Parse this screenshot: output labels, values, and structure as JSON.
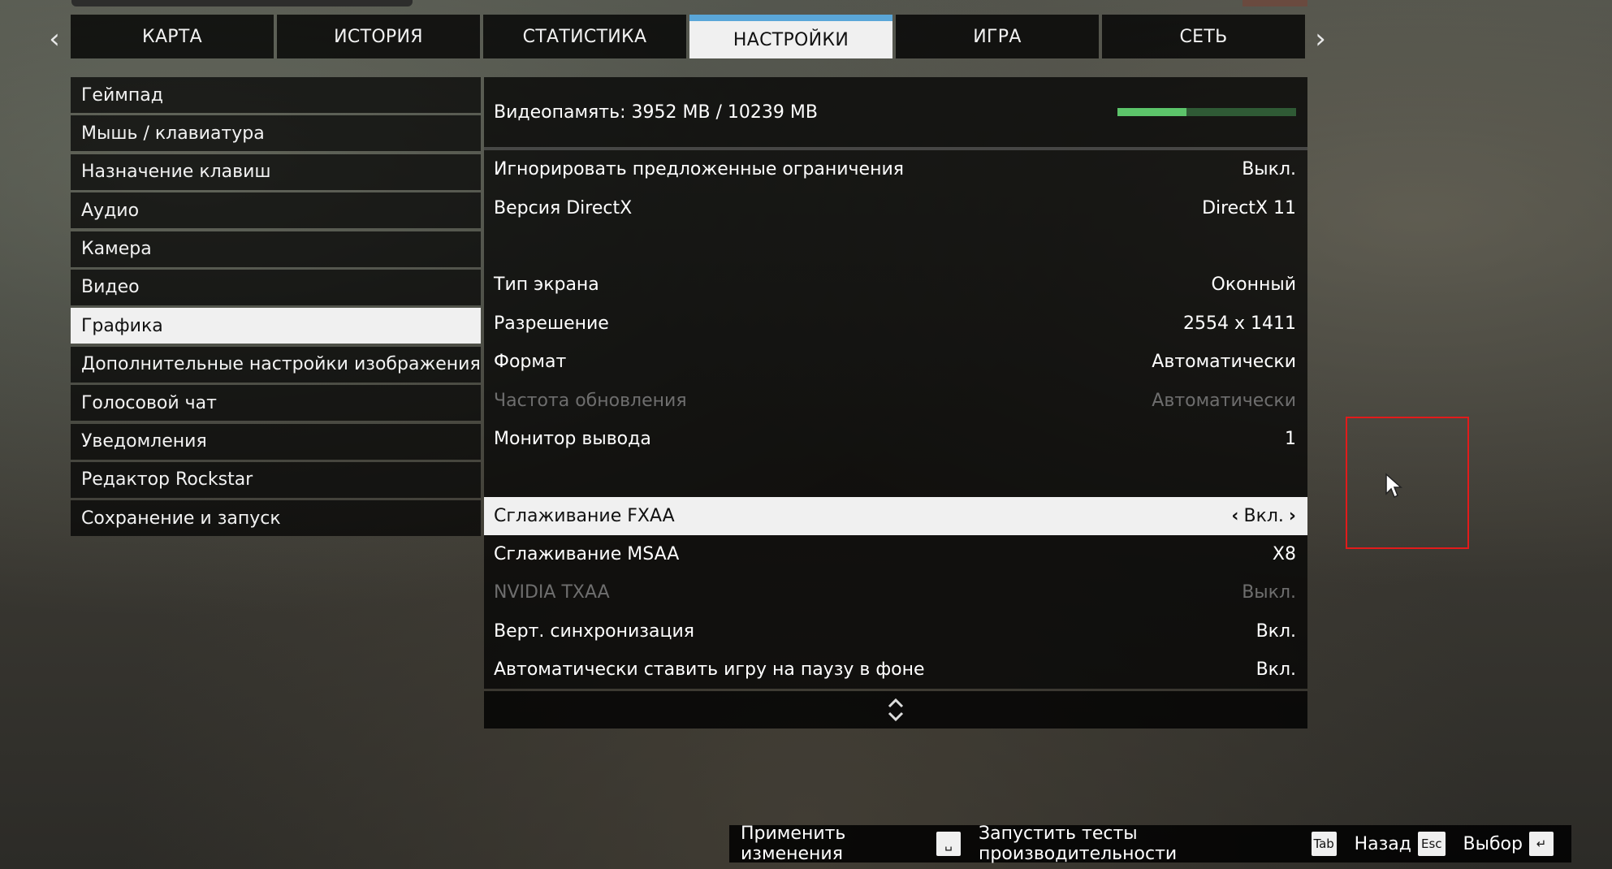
{
  "nav": {
    "left_arrow": "‹",
    "right_arrow": "›"
  },
  "tabs": [
    {
      "label": "КАРТА"
    },
    {
      "label": "ИСТОРИЯ"
    },
    {
      "label": "СТАТИСТИКА"
    },
    {
      "label": "НАСТРОЙКИ",
      "active": true
    },
    {
      "label": "ИГРА"
    },
    {
      "label": "СЕТЬ"
    }
  ],
  "left_menu": [
    {
      "label": "Геймпад"
    },
    {
      "label": "Мышь / клавиатура"
    },
    {
      "label": "Назначение клавиш"
    },
    {
      "label": "Аудио"
    },
    {
      "label": "Камера"
    },
    {
      "label": "Видео"
    },
    {
      "label": "Графика",
      "active": true
    },
    {
      "label": "Дополнительные настройки изображения"
    },
    {
      "label": "Голосовой чат"
    },
    {
      "label": "Уведомления"
    },
    {
      "label": "Редактор Rockstar"
    },
    {
      "label": "Сохранение и запуск"
    }
  ],
  "vram": {
    "label": "Видеопамять: 3952 MB / 10239 MB",
    "fraction": 0.386,
    "bar_color": "#5cc46a"
  },
  "settings": [
    {
      "label": "Игнорировать предложенные ограничения",
      "value": "Выкл."
    },
    {
      "label": "Версия DirectX",
      "value": "DirectX 11"
    },
    {
      "label": "",
      "value": "",
      "spacer": true
    },
    {
      "label": "Тип экрана",
      "value": "Оконный"
    },
    {
      "label": "Разрешение",
      "value": "2554 x 1411"
    },
    {
      "label": "Формат",
      "value": "Автоматически"
    },
    {
      "label": "Частота обновления",
      "value": "Автоматически",
      "disabled": true
    },
    {
      "label": "Монитор вывода",
      "value": "1"
    },
    {
      "label": "",
      "value": "",
      "spacer": true
    },
    {
      "label": "Сглаживание FXAA",
      "value": "Вкл.",
      "active": true
    },
    {
      "label": "Сглаживание MSAA",
      "value": "X8"
    },
    {
      "label": "NVIDIA TXAA",
      "value": "Выкл.",
      "disabled": true
    },
    {
      "label": "Верт. синхронизация",
      "value": "Вкл."
    },
    {
      "label": "Автоматически ставить игру на паузу в фоне",
      "value": "Вкл."
    }
  ],
  "scroll_icon": "updown-chevron-icon",
  "bottom_hints": [
    {
      "label": "Применить изменения",
      "key": "␣"
    },
    {
      "label": "Запустить тесты производительности",
      "key": "Tab"
    },
    {
      "label": "Назад",
      "key": "Esc"
    },
    {
      "label": "Выбор",
      "key": "↵"
    }
  ],
  "colors": {
    "tab_accent": "#5aa6d8",
    "highlight_box": "#e21b1b"
  }
}
